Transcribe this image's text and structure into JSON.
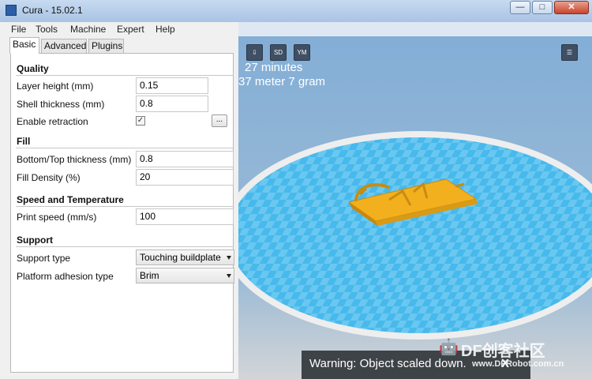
{
  "window": {
    "title": "Cura - 15.02.1"
  },
  "menubar": [
    "File",
    "Tools",
    "Machine",
    "Expert",
    "Help"
  ],
  "tabs": [
    "Basic",
    "Advanced",
    "Plugins"
  ],
  "sections": {
    "quality": "Quality",
    "fill": "Fill",
    "speed": "Speed and Temperature",
    "support": "Support"
  },
  "fields": {
    "layer_height": {
      "label": "Layer height (mm)",
      "value": "0.15"
    },
    "shell_thickness": {
      "label": "Shell thickness (mm)",
      "value": "0.8"
    },
    "enable_retraction": {
      "label": "Enable retraction",
      "checked": true,
      "button": "..."
    },
    "bottom_top_thickness": {
      "label": "Bottom/Top thickness (mm)",
      "value": "0.8"
    },
    "fill_density": {
      "label": "Fill Density (%)",
      "value": "20"
    },
    "print_speed": {
      "label": "Print speed (mm/s)",
      "value": "100"
    },
    "support_type": {
      "label": "Support type",
      "value": "Touching buildplate"
    },
    "platform_adhesion": {
      "label": "Platform adhesion type",
      "value": "Brim"
    }
  },
  "viewport": {
    "icons": [
      "SD",
      "YM"
    ],
    "time": "27 minutes",
    "material": "37 meter 7 gram",
    "warning": "Warning: Object scaled down.",
    "warning_close": "X"
  },
  "watermark": {
    "brand": "DF创客社区",
    "url": "www.DFRobot.com.cn"
  },
  "colors": {
    "model": "#f2b01e",
    "grid_blue": "#44b6ec",
    "grid_gray": "#ececec"
  }
}
